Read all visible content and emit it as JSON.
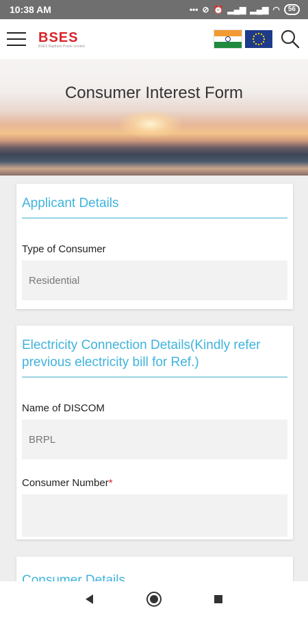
{
  "status_bar": {
    "time": "10:38 AM",
    "battery": "56"
  },
  "app_bar": {
    "logo_text": "BSES",
    "logo_subtitle": "BSES Rajdhani Power Limited"
  },
  "hero": {
    "title": "Consumer Interest Form"
  },
  "sections": {
    "applicant": {
      "title": "Applicant Details",
      "type_of_consumer_label": "Type of Consumer",
      "type_of_consumer_value": "Residential"
    },
    "electricity": {
      "title": "Electricity Connection Details(Kindly refer previous electricity bill for Ref.)",
      "discom_label": "Name of DISCOM",
      "discom_value": "BRPL",
      "consumer_number_label": "Consumer Number",
      "consumer_number_required": "*",
      "consumer_number_value": ""
    },
    "consumer": {
      "title": "Consumer Details"
    }
  },
  "icons": {
    "menu": "hamburger-menu-icon",
    "search": "search-icon",
    "back": "back-triangle-icon",
    "home": "home-circle-icon",
    "recents": "recents-square-icon"
  },
  "colors": {
    "accent": "#3fb3dc",
    "brand_red": "#d8232a",
    "status_bar": "#6f6f6f"
  }
}
